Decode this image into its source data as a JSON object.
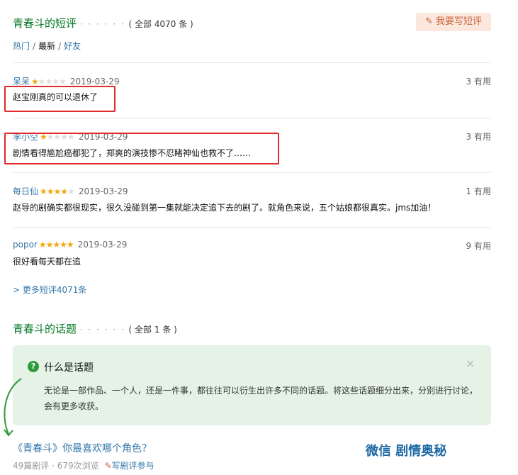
{
  "reviews_section": {
    "title": "青春斗的短评",
    "dots": "· · · · · ·",
    "count": "( 全部 4070 条 )",
    "write_button": "我要写短评",
    "sort": {
      "hot": "热门",
      "new": "最新",
      "friends": "好友"
    }
  },
  "comments": [
    {
      "user": "呆呆",
      "stars": 1,
      "date": "2019-03-29",
      "votes": "3",
      "votes_label": "有用",
      "text": "赵宝刚真的可以退休了"
    },
    {
      "user": "李小空",
      "stars": 1,
      "date": "2019-03-29",
      "votes": "3",
      "votes_label": "有用",
      "text": "剧情看得尴尬癌都犯了，郑爽的演技惨不忍睹神仙也救不了……"
    },
    {
      "user": "每日仙",
      "stars": 4,
      "date": "2019-03-29",
      "votes": "1",
      "votes_label": "有用",
      "text": "赵导的剧确实都很现实，很久没碰到第一集就能决定追下去的剧了。就角色来说，五个姑娘都很真实。jms加油！"
    },
    {
      "user": "popor",
      "stars": 5,
      "date": "2019-03-29",
      "votes": "9",
      "votes_label": "有用",
      "text": "很好看每天都在追"
    }
  ],
  "more_link": "> 更多短评4071条",
  "topics_section": {
    "title": "青春斗的话题",
    "dots": "· · · · · ·",
    "count": "( 全部 1 条 )",
    "box_title": "什么是话题",
    "box_desc": "无论是一部作品、一个人，还是一件事，都往往可以衍生出许多不同的话题。将这些话题细分出来，分别进行讨论，会有更多收获。",
    "close_symbol": "×",
    "topic_title": "《青春斗》你最喜欢哪个角色？",
    "topic_meta": "49篇剧评 · 679次浏览",
    "topic_action": "写剧评参与"
  },
  "watermark": "微信 剧情奥秘",
  "colors": {
    "accent_green": "#007722",
    "link_blue": "#3377aa",
    "highlight_red": "#e02b2b",
    "star": "#f4a70c"
  }
}
